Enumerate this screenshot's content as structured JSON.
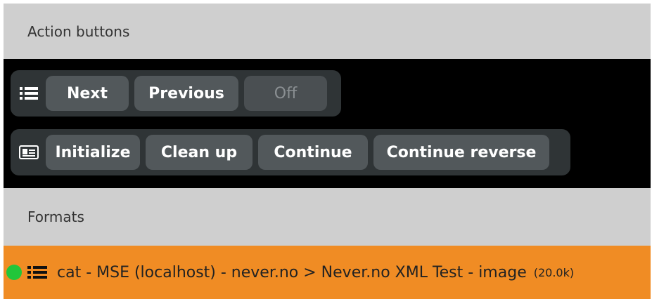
{
  "sections": {
    "actions_header": "Action buttons",
    "formats_header": "Formats"
  },
  "group1": {
    "icon": "list-icon",
    "buttons": [
      {
        "label": "Next",
        "enabled": true
      },
      {
        "label": "Previous",
        "enabled": true
      },
      {
        "label": "Off",
        "enabled": false
      }
    ]
  },
  "group2": {
    "icon": "id-card-icon",
    "buttons": [
      {
        "label": "Initialize",
        "enabled": true
      },
      {
        "label": "Clean up",
        "enabled": true
      },
      {
        "label": "Continue",
        "enabled": true
      },
      {
        "label": "Continue reverse",
        "enabled": true
      }
    ]
  },
  "format_item": {
    "status": "online",
    "status_color": "#22c63a",
    "icon": "list-icon",
    "label": "cat - MSE (localhost) - never.no > Never.no XML Test - image",
    "size": "(20.0k)",
    "row_color": "#f08c24"
  },
  "colors": {
    "header_bg": "#cfcfcf",
    "toolbar_bg": "#000000",
    "group_bg": "#2f3436",
    "button_bg": "#52585b"
  }
}
